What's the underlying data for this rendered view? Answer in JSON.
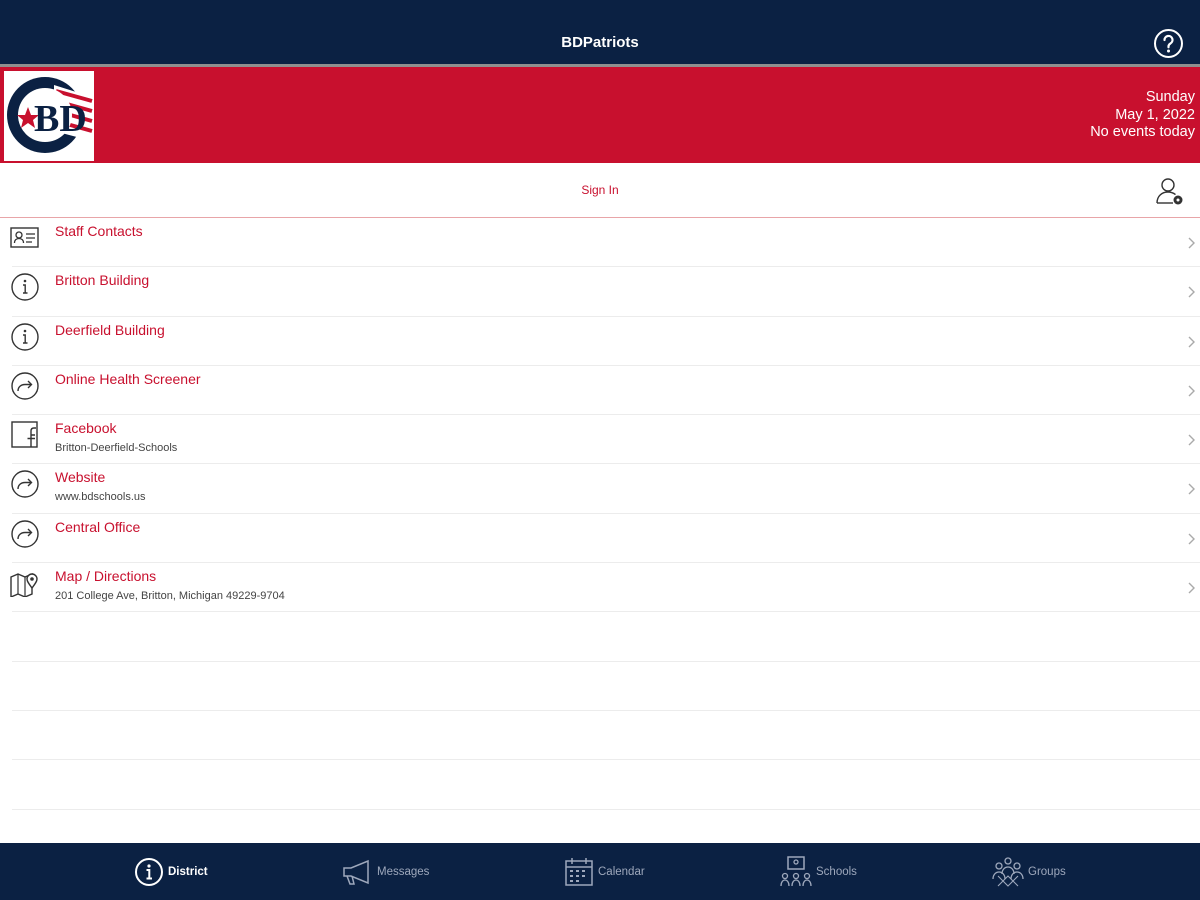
{
  "header": {
    "title": "BDPatriots",
    "help_icon": "help-circle-icon"
  },
  "banner": {
    "logo_text": "BD",
    "day": "Sunday",
    "date": "May 1, 2022",
    "events": "No events today",
    "colors": {
      "banner_bg": "#c8102e",
      "header_bg": "#0b2143"
    }
  },
  "signin": {
    "label": "Sign In",
    "icon": "user-settings-icon"
  },
  "list": {
    "items": [
      {
        "label": "Staff Contacts",
        "sub": "",
        "icon": "contact-card-icon"
      },
      {
        "label": "Britton Building",
        "sub": "",
        "icon": "info-icon"
      },
      {
        "label": "Deerfield Building",
        "sub": "",
        "icon": "info-icon"
      },
      {
        "label": "Online Health Screener",
        "sub": "",
        "icon": "share-arrow-icon"
      },
      {
        "label": "Facebook",
        "sub": "Britton-Deerfield-Schools",
        "icon": "facebook-icon"
      },
      {
        "label": "Website",
        "sub": "www.bdschools.us",
        "icon": "share-arrow-icon"
      },
      {
        "label": "Central Office",
        "sub": "",
        "icon": "share-arrow-icon"
      },
      {
        "label": "Map / Directions",
        "sub": "201 College Ave, Britton, Michigan 49229-9704",
        "icon": "map-pin-icon"
      }
    ]
  },
  "tabs": [
    {
      "label": "District",
      "icon": "info-icon",
      "active": true
    },
    {
      "label": "Messages",
      "icon": "megaphone-icon",
      "active": false
    },
    {
      "label": "Calendar",
      "icon": "calendar-icon",
      "active": false
    },
    {
      "label": "Schools",
      "icon": "schools-icon",
      "active": false
    },
    {
      "label": "Groups",
      "icon": "groups-icon",
      "active": false
    }
  ]
}
